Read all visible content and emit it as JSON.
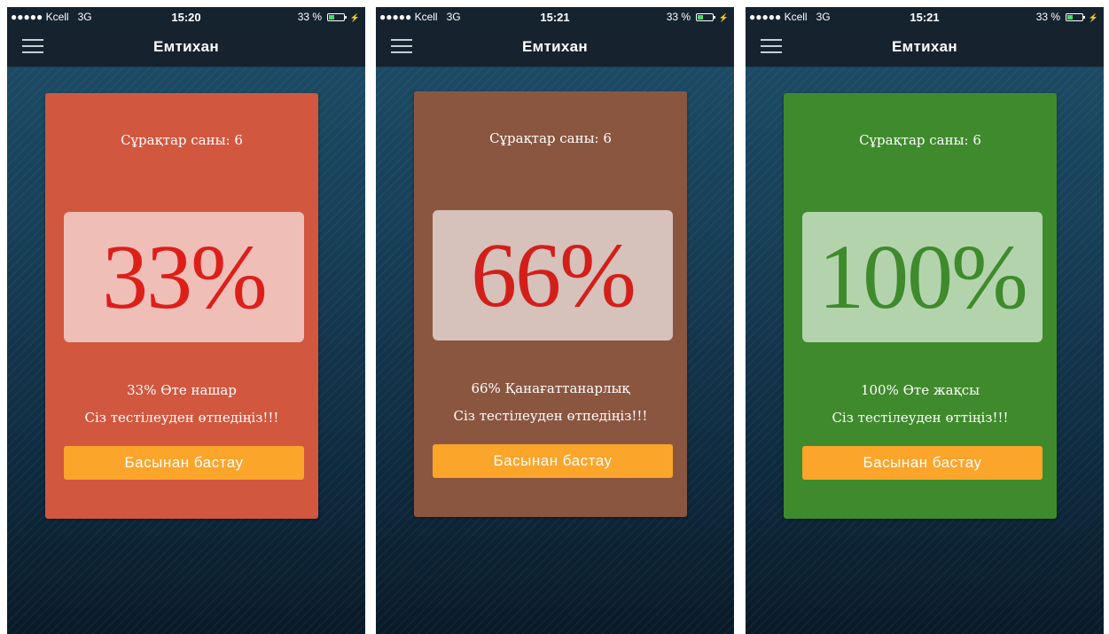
{
  "screens": [
    {
      "status": {
        "carrier": "●●●●● Kcell",
        "network": "3G",
        "time": "15:20",
        "battery": "33 %"
      },
      "nav": {
        "title": "Емтихан"
      },
      "card": {
        "question_count": "Сұрақтар саны: 6",
        "score": "33%",
        "result_line": "33% Өте нашар",
        "message": "Сіз тестілеуден өтпедіңіз!!!",
        "button": "Басынан бастау",
        "card_color": "#d2573f",
        "score_box_color": "#efbeb7",
        "score_color": "#dd1f1a"
      }
    },
    {
      "status": {
        "carrier": "●●●●● Kcell",
        "network": "3G",
        "time": "15:21",
        "battery": "33 %"
      },
      "nav": {
        "title": "Емтихан"
      },
      "card": {
        "question_count": "Сұрақтар саны: 6",
        "score": "66%",
        "result_line": "66% Қанағаттанарлық",
        "message": "Сіз тестілеуден өтпедіңіз!!!",
        "button": "Басынан бастау",
        "card_color": "#8b5640",
        "score_box_color": "#d6c1bb",
        "score_color": "#d31f1a"
      }
    },
    {
      "status": {
        "carrier": "●●●●● Kcell",
        "network": "3G",
        "time": "15:21",
        "battery": "33 %"
      },
      "nav": {
        "title": "Емтихан"
      },
      "card": {
        "question_count": "Сұрақтар саны: 6",
        "score": "100%",
        "result_line": "100% Өте жақсы",
        "message": "Сіз тестілеуден өттіңіз!!!",
        "button": "Басынан бастау",
        "card_color": "#3f8a2c",
        "score_box_color": "#b3d3ad",
        "score_color": "#3f8a2c"
      }
    }
  ]
}
